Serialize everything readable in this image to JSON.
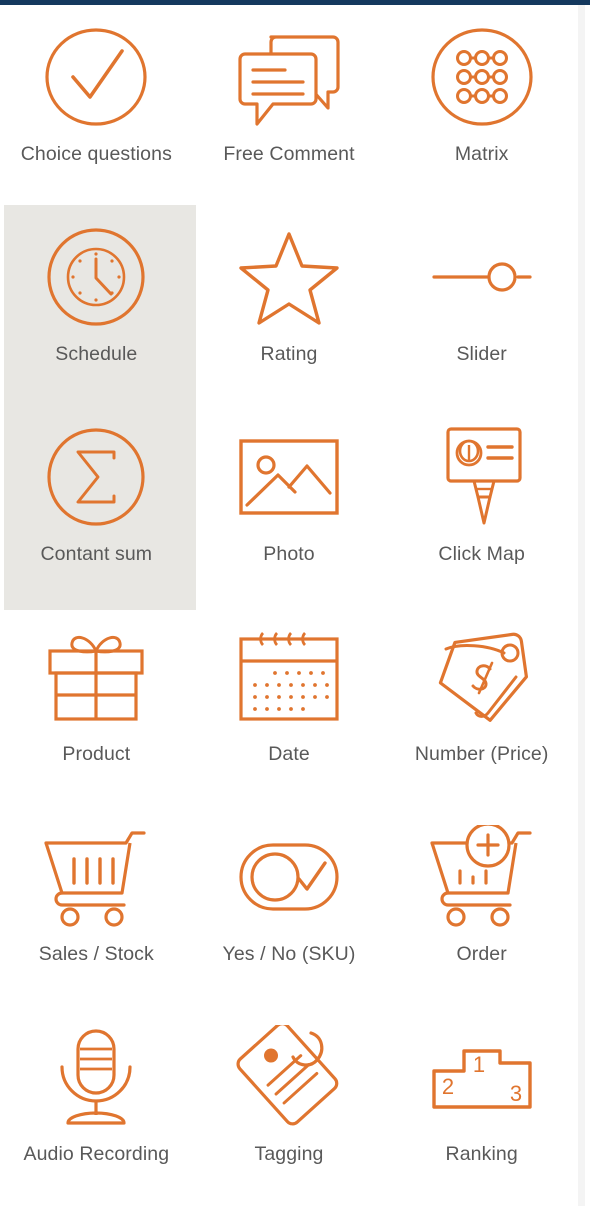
{
  "theme": {
    "accent_color": "#E0752F",
    "label_color": "#595959",
    "highlight_background": "#E8E7E3",
    "top_bar_color": "#14395E",
    "page_background": "#FFFFFF"
  },
  "grid": {
    "columns": 3,
    "rows": 6,
    "items": [
      {
        "label": "Choice questions",
        "icon": "check-circle-icon",
        "highlighted": false
      },
      {
        "label": "Free Comment",
        "icon": "chat-bubbles-icon",
        "highlighted": false
      },
      {
        "label": "Matrix",
        "icon": "matrix-circle-icon",
        "highlighted": false
      },
      {
        "label": "Schedule",
        "icon": "clock-circle-icon",
        "highlighted": true
      },
      {
        "label": "Rating",
        "icon": "star-icon",
        "highlighted": false
      },
      {
        "label": "Slider",
        "icon": "slider-icon",
        "highlighted": false
      },
      {
        "label": "Contant sum",
        "icon": "sigma-circle-icon",
        "highlighted": true
      },
      {
        "label": "Photo",
        "icon": "photo-icon",
        "highlighted": false
      },
      {
        "label": "Click Map",
        "icon": "click-map-icon",
        "highlighted": false
      },
      {
        "label": "Product",
        "icon": "gift-box-icon",
        "highlighted": false
      },
      {
        "label": "Date",
        "icon": "calendar-icon",
        "highlighted": false
      },
      {
        "label": "Number (Price)",
        "icon": "price-tags-icon",
        "highlighted": false
      },
      {
        "label": "Sales / Stock",
        "icon": "shopping-cart-bars-icon",
        "highlighted": false
      },
      {
        "label": "Yes / No (SKU)",
        "icon": "toggle-check-icon",
        "highlighted": false
      },
      {
        "label": "Order",
        "icon": "cart-plus-icon",
        "highlighted": false
      },
      {
        "label": "Audio Recording",
        "icon": "microphone-icon",
        "highlighted": false
      },
      {
        "label": "Tagging",
        "icon": "tag-icon",
        "highlighted": false
      },
      {
        "label": "Ranking",
        "icon": "podium-icon",
        "highlighted": false
      }
    ]
  },
  "ranking_icon_numbers": {
    "first": "1",
    "second": "2",
    "third": "3"
  }
}
